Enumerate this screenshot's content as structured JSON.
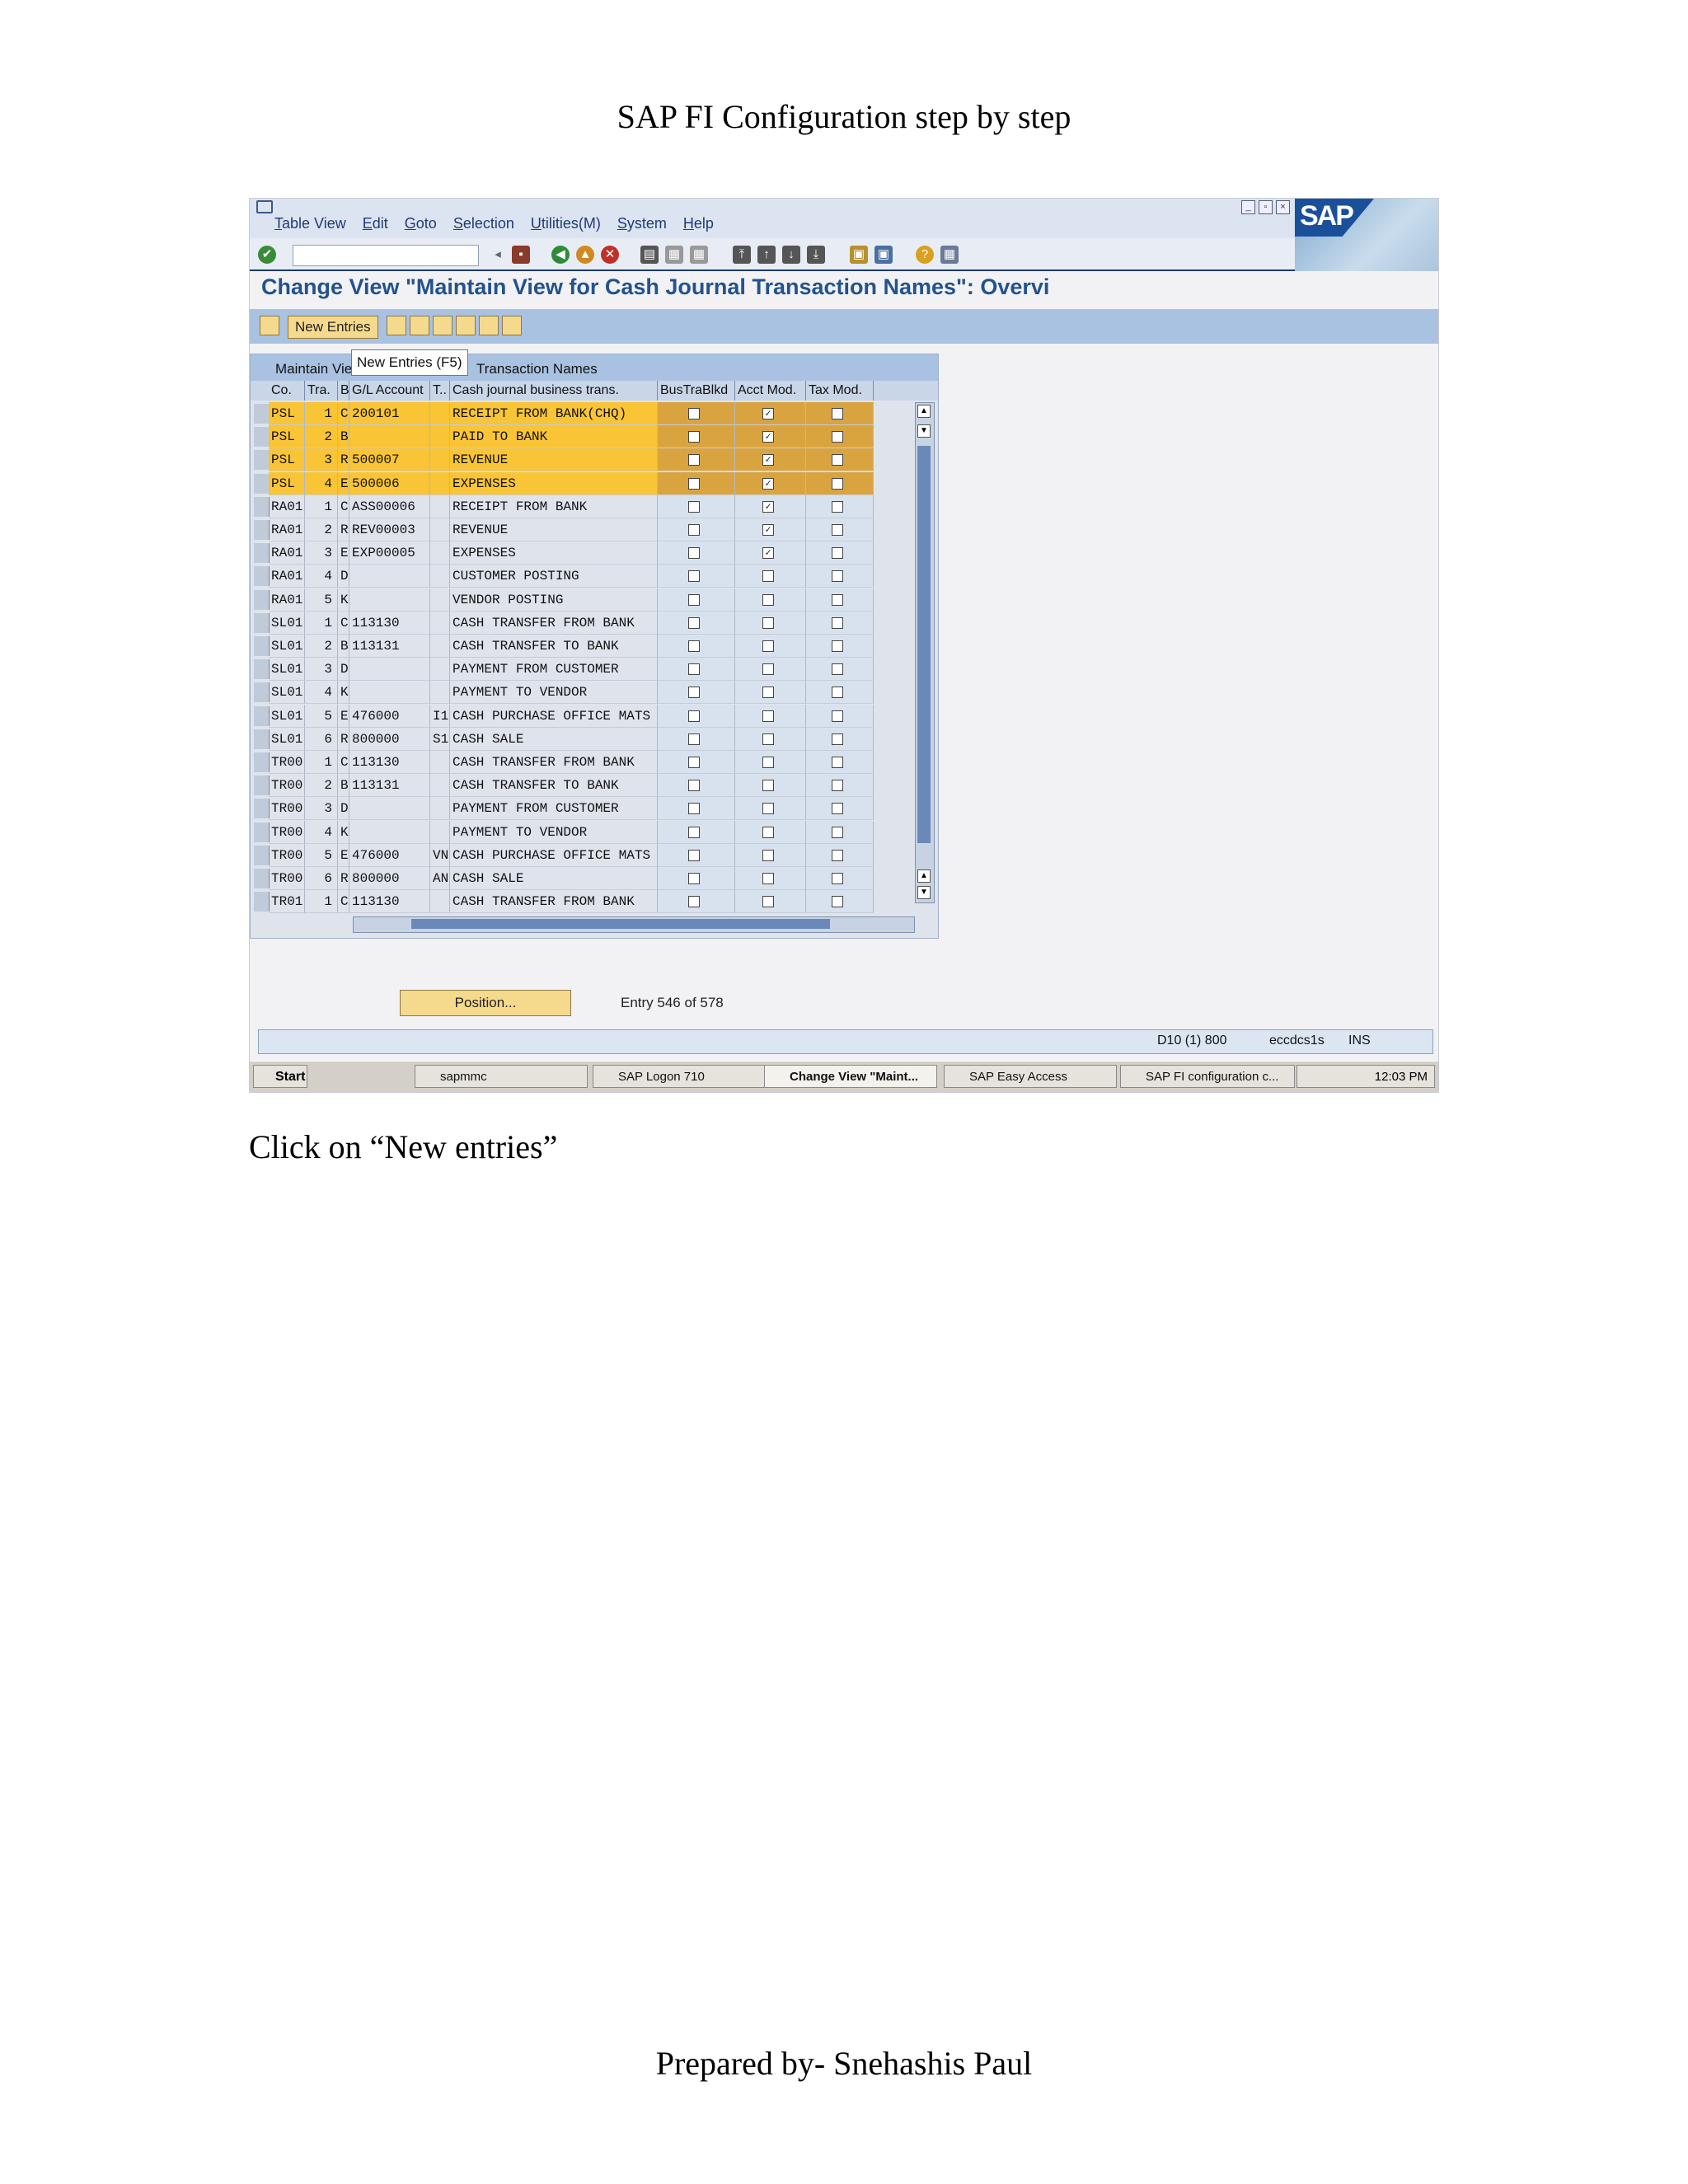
{
  "doc": {
    "title": "SAP FI Configuration step by step",
    "caption": "Click on “New entries”",
    "footer": "Prepared by- Snehashis Paul"
  },
  "sap": {
    "menu": [
      "Table View",
      "Edit",
      "Goto",
      "Selection",
      "Utilities(M)",
      "System",
      "Help"
    ],
    "logo": "SAP",
    "screen_title": "Change View \"Maintain View for Cash Journal Transaction Names\": Overvi",
    "new_entries_label": "New Entries",
    "tooltip": "New Entries   (F5)",
    "table_title_left": "Maintain Vie",
    "table_title_right": "Transaction Names",
    "columns": [
      "Co.",
      "Tra.",
      "B",
      "G/L Account",
      "T..",
      "Cash journal business trans.",
      "BusTraBlkd",
      "Acct Mod.",
      "Tax Mod."
    ],
    "rows": [
      {
        "co": "PSL",
        "tra": "1",
        "b": "C",
        "gl": "200101",
        "t": "",
        "name": "RECEIPT FROM BANK(CHQ)",
        "blkd": false,
        "acct": true,
        "tax": false,
        "hl": true
      },
      {
        "co": "PSL",
        "tra": "2",
        "b": "B",
        "gl": "",
        "t": "",
        "name": "PAID TO BANK",
        "blkd": false,
        "acct": true,
        "tax": false,
        "hl": true
      },
      {
        "co": "PSL",
        "tra": "3",
        "b": "R",
        "gl": "500007",
        "t": "",
        "name": "REVENUE",
        "blkd": false,
        "acct": true,
        "tax": false,
        "hl": true
      },
      {
        "co": "PSL",
        "tra": "4",
        "b": "E",
        "gl": "500006",
        "t": "",
        "name": "EXPENSES",
        "blkd": false,
        "acct": true,
        "tax": false,
        "hl": true
      },
      {
        "co": "RA01",
        "tra": "1",
        "b": "C",
        "gl": "ASS00006",
        "t": "",
        "name": "RECEIPT FROM BANK",
        "blkd": false,
        "acct": true,
        "tax": false,
        "hl": false
      },
      {
        "co": "RA01",
        "tra": "2",
        "b": "R",
        "gl": "REV00003",
        "t": "",
        "name": "REVENUE",
        "blkd": false,
        "acct": true,
        "tax": false,
        "hl": false
      },
      {
        "co": "RA01",
        "tra": "3",
        "b": "E",
        "gl": "EXP00005",
        "t": "",
        "name": "EXPENSES",
        "blkd": false,
        "acct": true,
        "tax": false,
        "hl": false
      },
      {
        "co": "RA01",
        "tra": "4",
        "b": "D",
        "gl": "",
        "t": "",
        "name": "CUSTOMER POSTING",
        "blkd": false,
        "acct": false,
        "tax": false,
        "hl": false
      },
      {
        "co": "RA01",
        "tra": "5",
        "b": "K",
        "gl": "",
        "t": "",
        "name": "VENDOR POSTING",
        "blkd": false,
        "acct": false,
        "tax": false,
        "hl": false
      },
      {
        "co": "SL01",
        "tra": "1",
        "b": "C",
        "gl": "113130",
        "t": "",
        "name": "CASH TRANSFER FROM BANK",
        "blkd": false,
        "acct": false,
        "tax": false,
        "hl": false
      },
      {
        "co": "SL01",
        "tra": "2",
        "b": "B",
        "gl": "113131",
        "t": "",
        "name": "CASH TRANSFER TO BANK",
        "blkd": false,
        "acct": false,
        "tax": false,
        "hl": false
      },
      {
        "co": "SL01",
        "tra": "3",
        "b": "D",
        "gl": "",
        "t": "",
        "name": "PAYMENT FROM CUSTOMER",
        "blkd": false,
        "acct": false,
        "tax": false,
        "hl": false
      },
      {
        "co": "SL01",
        "tra": "4",
        "b": "K",
        "gl": "",
        "t": "",
        "name": "PAYMENT TO VENDOR",
        "blkd": false,
        "acct": false,
        "tax": false,
        "hl": false
      },
      {
        "co": "SL01",
        "tra": "5",
        "b": "E",
        "gl": "476000",
        "t": "I1",
        "name": "CASH PURCHASE OFFICE MATS",
        "blkd": false,
        "acct": false,
        "tax": false,
        "hl": false
      },
      {
        "co": "SL01",
        "tra": "6",
        "b": "R",
        "gl": "800000",
        "t": "S1",
        "name": "CASH SALE",
        "blkd": false,
        "acct": false,
        "tax": false,
        "hl": false
      },
      {
        "co": "TR00",
        "tra": "1",
        "b": "C",
        "gl": "113130",
        "t": "",
        "name": "CASH TRANSFER FROM BANK",
        "blkd": false,
        "acct": false,
        "tax": false,
        "hl": false
      },
      {
        "co": "TR00",
        "tra": "2",
        "b": "B",
        "gl": "113131",
        "t": "",
        "name": "CASH TRANSFER TO BANK",
        "blkd": false,
        "acct": false,
        "tax": false,
        "hl": false
      },
      {
        "co": "TR00",
        "tra": "3",
        "b": "D",
        "gl": "",
        "t": "",
        "name": "PAYMENT FROM CUSTOMER",
        "blkd": false,
        "acct": false,
        "tax": false,
        "hl": false
      },
      {
        "co": "TR00",
        "tra": "4",
        "b": "K",
        "gl": "",
        "t": "",
        "name": "PAYMENT TO VENDOR",
        "blkd": false,
        "acct": false,
        "tax": false,
        "hl": false
      },
      {
        "co": "TR00",
        "tra": "5",
        "b": "E",
        "gl": "476000",
        "t": "VN",
        "name": "CASH PURCHASE OFFICE MATS",
        "blkd": false,
        "acct": false,
        "tax": false,
        "hl": false
      },
      {
        "co": "TR00",
        "tra": "6",
        "b": "R",
        "gl": "800000",
        "t": "AN",
        "name": "CASH SALE",
        "blkd": false,
        "acct": false,
        "tax": false,
        "hl": false
      },
      {
        "co": "TR01",
        "tra": "1",
        "b": "C",
        "gl": "113130",
        "t": "",
        "name": "CASH TRANSFER FROM BANK",
        "blkd": false,
        "acct": false,
        "tax": false,
        "hl": false
      }
    ],
    "position_label": "Position...",
    "entry_text": "Entry 546 of 578",
    "status": {
      "system": "D10 (1) 800",
      "server": "eccdcs1s",
      "mode": "INS"
    },
    "taskbar": {
      "start": "Start",
      "items": [
        "sapmmc",
        "SAP Logon 710",
        "Change View \"Maint...",
        "SAP Easy Access",
        "SAP FI configuration c..."
      ],
      "clock": "12:03 PM"
    }
  }
}
